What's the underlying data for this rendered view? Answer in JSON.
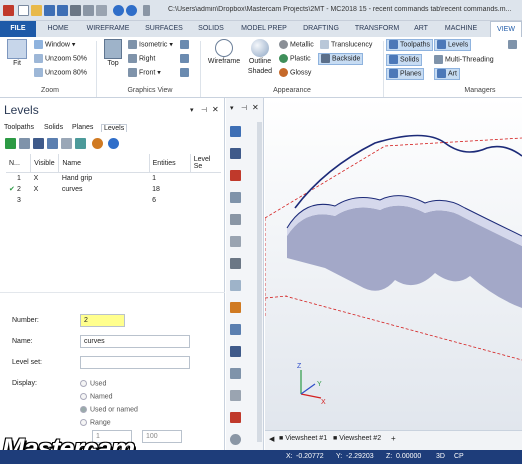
{
  "window": {
    "title": "C:\\Users\\admin\\Dropbox\\Mastercam Projects\\2MT - MC2018 15 - recent commands tab\\recent commands.m..."
  },
  "tabs": [
    "FILE",
    "HOME",
    "WIREFRAME",
    "SURFACES",
    "SOLIDS",
    "MODEL PREP",
    "DRAFTING",
    "TRANSFORM",
    "ART",
    "MACHINE",
    "VIEW"
  ],
  "ribbon": {
    "zoom": {
      "fit": "Fit",
      "window": "Window",
      "unzoom50": "Unzoom 50%",
      "unzoom80": "Unzoom 80%",
      "group": "Zoom"
    },
    "graphics": {
      "top": "Top",
      "isometric": "Isometric",
      "right": "Right",
      "front": "Front",
      "group": "Graphics View"
    },
    "appearance": {
      "wireframe": "Wireframe",
      "outline": "Outline",
      "outline2": "Shaded",
      "metallic": "Metallic",
      "plastic": "Plastic",
      "glossy": "Glossy",
      "translucency": "Translucency",
      "backside": "Backside",
      "group": "Appearance"
    },
    "managers": {
      "toolpaths": "Toolpaths",
      "levels": "Levels",
      "solids": "Solids",
      "multithreading": "Multi-Threading",
      "planes": "Planes",
      "art": "Art",
      "group": "Managers"
    }
  },
  "levels": {
    "title": "Levels",
    "tabs": [
      "Toolpaths",
      "Solids",
      "Planes",
      "Levels"
    ],
    "columns": [
      "N...",
      "Visible",
      "Name",
      "Entities",
      "Level Se"
    ],
    "rows": [
      {
        "num": "1",
        "visible": "X",
        "name": "Hand grip",
        "entities": "1",
        "active": ""
      },
      {
        "num": "2",
        "visible": "X",
        "name": "curves",
        "entities": "18",
        "active": "✔"
      },
      {
        "num": "3",
        "visible": "",
        "name": "",
        "entities": "6",
        "active": ""
      }
    ],
    "form": {
      "number_label": "Number:",
      "number_value": "2",
      "name_label": "Name:",
      "name_value": "curves",
      "levelset_label": "Level set:",
      "levelset_value": "",
      "display_label": "Display:",
      "opt_used": "Used",
      "opt_named": "Named",
      "opt_usedornamed": "Used or named",
      "opt_range": "Range",
      "range_from": "1",
      "range_to": "100"
    }
  },
  "sheets": [
    "Viewsheet #1",
    "Viewsheet #2"
  ],
  "status": {
    "x_label": "X:",
    "x_value": "-0.20772",
    "y_label": "Y:",
    "y_value": "-2.29203",
    "z_label": "Z:",
    "z_value": "0.00000",
    "mode": "3D",
    "cp": "CP"
  },
  "logo": "Mastercam",
  "colors": {
    "accent": "#1e5aa8",
    "status_bg": "#1e3d7a",
    "selected": "#c7dcf3",
    "part": "#a3a8c8",
    "wire": "#1c2a78",
    "dashed": "#d42020"
  }
}
